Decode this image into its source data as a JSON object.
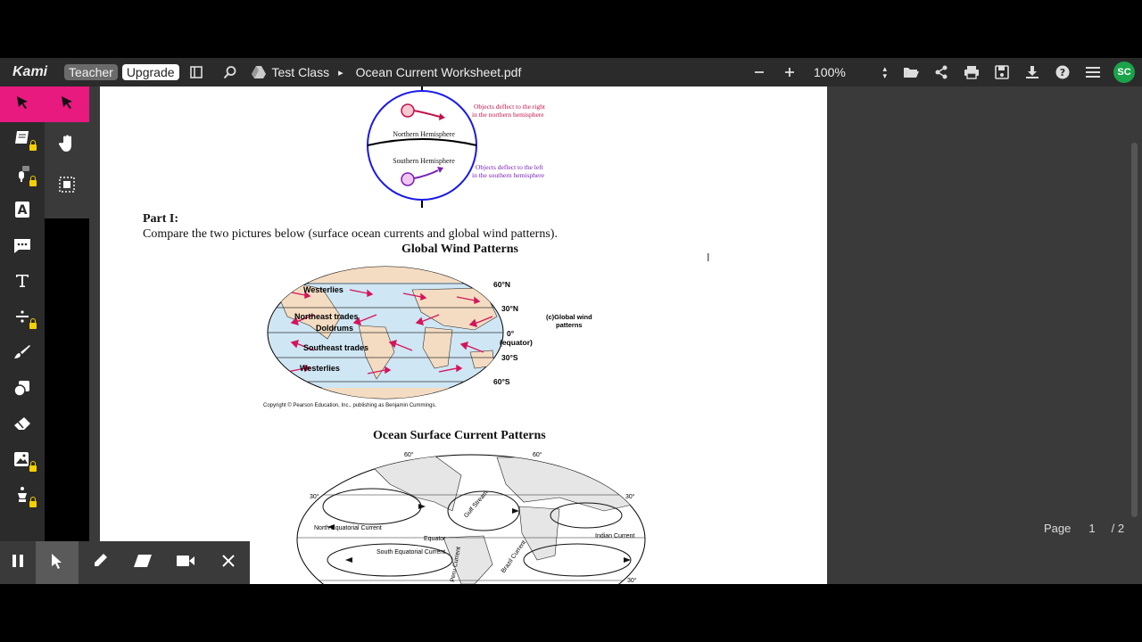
{
  "app": {
    "logo": "Kami",
    "role_badge": "Teacher",
    "upgrade_label": "Upgrade"
  },
  "breadcrumb": {
    "class_name": "Test Class",
    "separator": "▸",
    "file_name": "Ocean Current Worksheet.pdf"
  },
  "toolbar": {
    "zoom_value": "100%",
    "avatar_initials": "SC"
  },
  "sidebar": {
    "tools": [
      "select-tool",
      "textbook-tool",
      "voice-comment-tool",
      "markup-tool",
      "comment-tool",
      "text-tool",
      "equation-tool",
      "drawing-tool",
      "shapes-tool",
      "eraser-tool",
      "image-tool",
      "signature-tool"
    ]
  },
  "document": {
    "coriolis": {
      "north_label": "Northern Hemisphere",
      "south_label": "Southern Hemisphere",
      "right_note_line1": "Objects deflect to the right",
      "right_note_line2": "in the northern hemisphere",
      "left_note_line1": "Objects deflect to the left",
      "left_note_line2": "in the southern hemisphere"
    },
    "part_heading": "Part I:",
    "instruction": "Compare the two pictures below (surface ocean currents and global wind patterns).",
    "wind_title": "Global Wind Patterns",
    "wind_map": {
      "labels": [
        "Westerlies",
        "Northeast trades",
        "Doldrums",
        "Southeast trades",
        "Westerlies"
      ],
      "latitudes": [
        "60°N",
        "30°N",
        "0°",
        "(equator)",
        "30°S",
        "60°S"
      ],
      "caption_line1": "(c)Global wind",
      "caption_line2": "patterns",
      "copyright": "Copyright © Pearson Education, Inc., publishing as Benjamin Cummings."
    },
    "ocean_title": "Ocean Surface Current Patterns",
    "ocean_map": {
      "labels": [
        "North Equatorial Current",
        "Equator",
        "South Equatorial Current",
        "Gulf Stream",
        "Brazil Current",
        "Peru Current",
        "Indian Current"
      ],
      "degrees": [
        "60°",
        "60°",
        "30°",
        "30°",
        "30°"
      ]
    }
  },
  "pager": {
    "label": "Page",
    "current": "1",
    "total": "/ 2"
  }
}
